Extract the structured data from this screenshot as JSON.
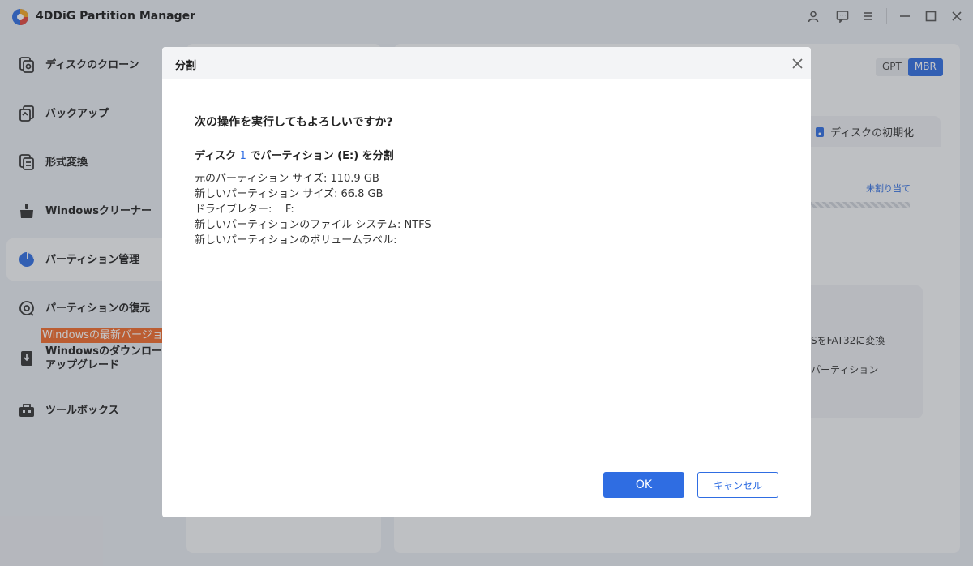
{
  "app": {
    "title": "4DDiG Partition Manager"
  },
  "sidebar": {
    "items": [
      {
        "label": "ディスクのクローン",
        "icon": "disk-clone-icon"
      },
      {
        "label": "バックアップ",
        "icon": "backup-icon"
      },
      {
        "label": "形式変換",
        "icon": "format-convert-icon"
      },
      {
        "label": "Windowsクリーナー",
        "icon": "cleaner-icon"
      },
      {
        "label": "パーティション管理",
        "icon": "pie-chart-icon",
        "active": true
      },
      {
        "label": "パーティションの復元",
        "icon": "partition-recovery-icon"
      },
      {
        "label": "Windowsのダウンロード/\nアップグレード",
        "icon": "windows-download-icon"
      },
      {
        "label": "ツールボックス",
        "icon": "toolbox-icon"
      }
    ],
    "promo": "Windowsの最新バージョン"
  },
  "right": {
    "gpt": "GPT",
    "mbr": "MBR",
    "init_tab": "ディスクの初期化",
    "unallocated": "未割り当て",
    "ops": [
      "SをFAT32に変換",
      "パーティション"
    ]
  },
  "dialog": {
    "title": "分割",
    "question": "次の操作を実行してもよろしいですか?",
    "op_prefix": "ディスク",
    "op_disk_num": "1",
    "op_suffix": "でパーティション (E:) を分割",
    "details": [
      "元のパーティション サイズ: 110.9 GB",
      "新しいパーティション サイズ: 66.8 GB",
      "ドライブレター:    F:",
      "新しいパーティションのファイル システム: NTFS",
      "新しいパーティションのボリュームラベル:"
    ],
    "ok": "OK",
    "cancel": "キャンセル"
  },
  "colors": {
    "accent": "#2f6de2",
    "promo": "#f26b2a"
  }
}
